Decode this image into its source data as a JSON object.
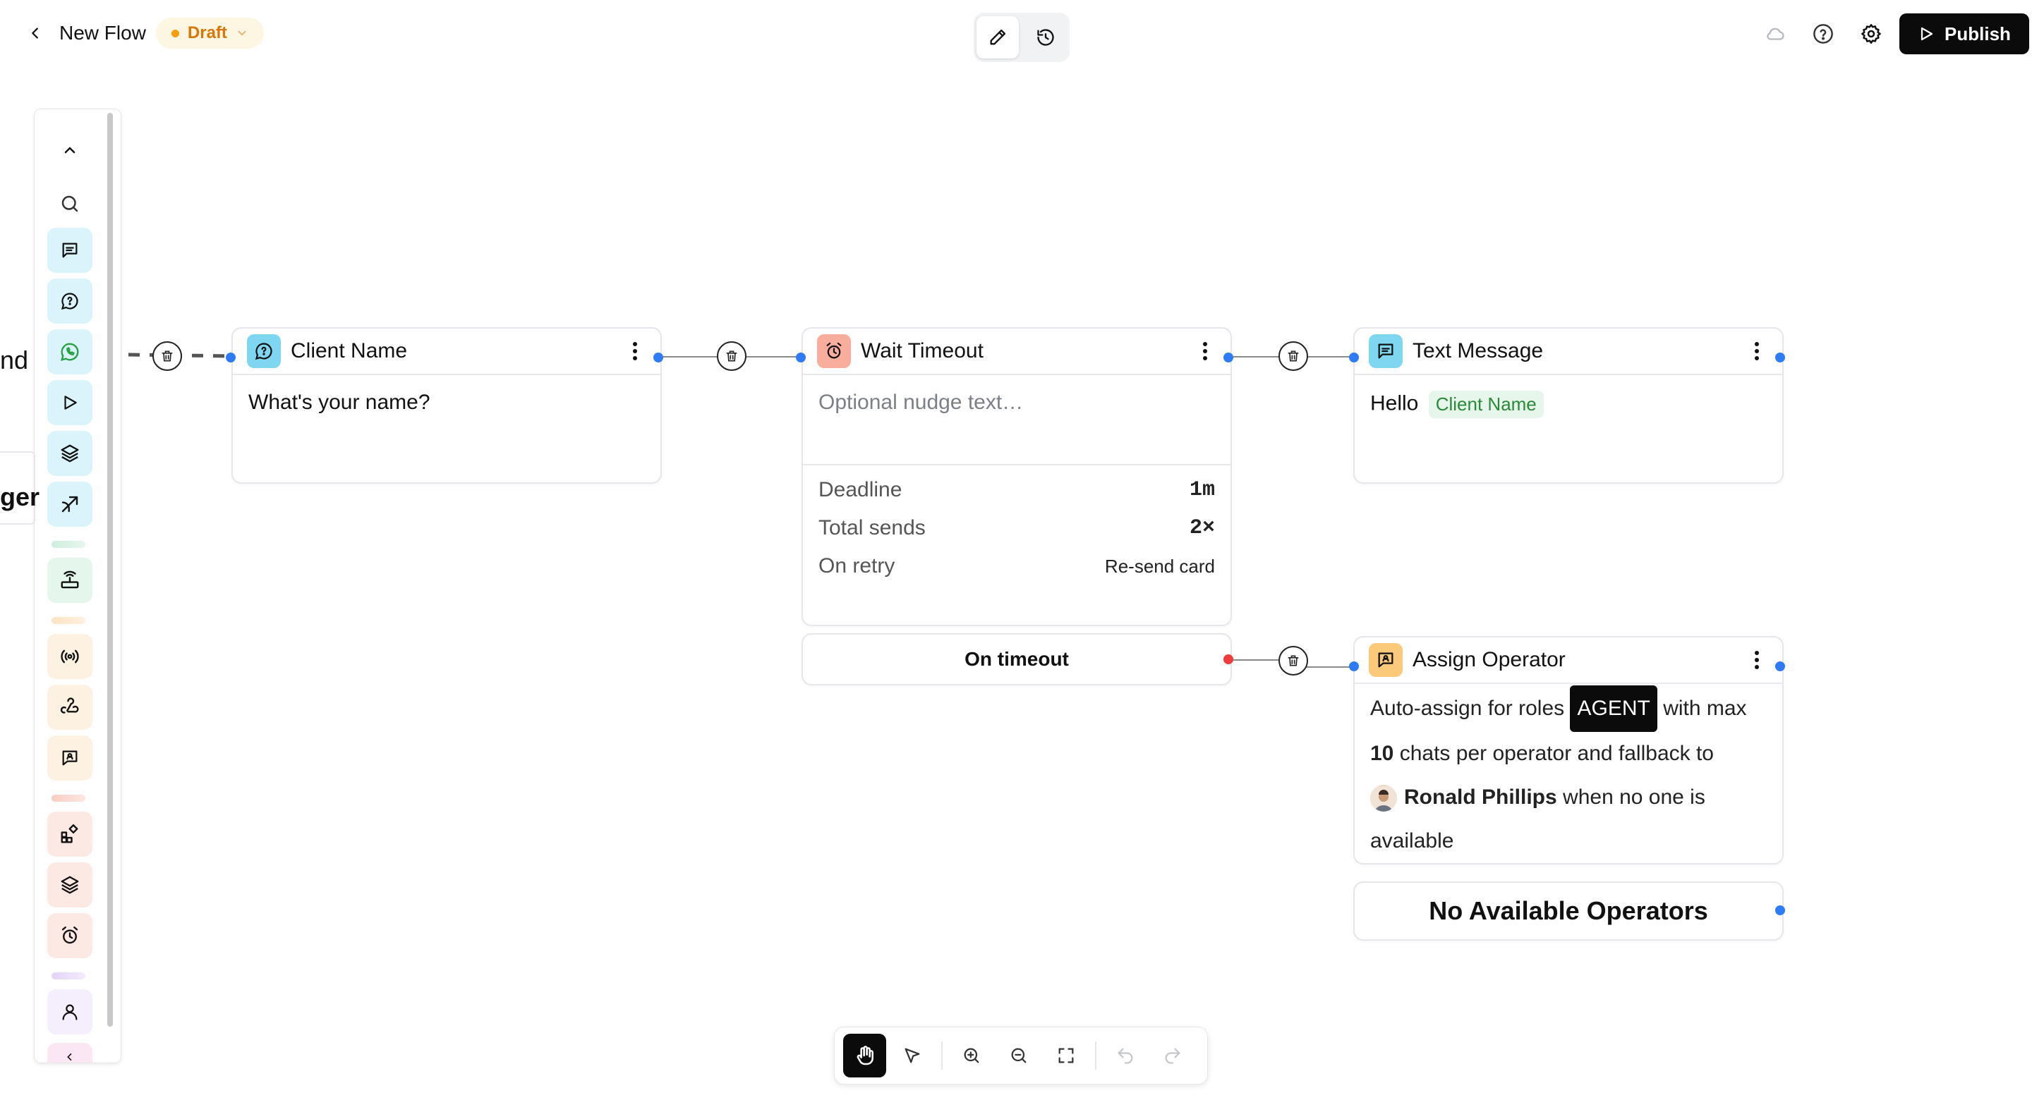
{
  "header": {
    "title": "New Flow",
    "status": "Draft",
    "publish_label": "Publish"
  },
  "canvas_fragments": {
    "left_text_1": "nd",
    "left_text_2": "ger"
  },
  "nodes": {
    "client_name": {
      "title": "Client Name",
      "body": "What's your name?"
    },
    "wait_timeout": {
      "title": "Wait Timeout",
      "placeholder": "Optional nudge text…",
      "rows": [
        {
          "label": "Deadline",
          "value": "1m"
        },
        {
          "label": "Total sends",
          "value": "2×"
        },
        {
          "label": "On retry",
          "value": "Re-send card"
        }
      ],
      "on_timeout_label": "On timeout"
    },
    "text_message": {
      "title": "Text Message",
      "greeting": "Hello",
      "variable": "Client Name"
    },
    "assign_operator": {
      "title": "Assign Operator",
      "text_1": "Auto-assign for roles",
      "role": "AGENT",
      "text_2": "with max",
      "max_chats": "10",
      "text_3": "chats per operator and fallback to",
      "fallback_name": "Ronald Phillips",
      "text_4": "when no one is",
      "text_5": "available",
      "no_operators_label": "No Available Operators"
    }
  },
  "colors": {
    "accent": "#2f7bf5",
    "timeout_port": "#ef3b3b",
    "draft": "#d97706",
    "publish_bg": "#0b0b0b"
  },
  "palette_icons": [
    "chevron-up-icon",
    "search-icon",
    "message-square-icon",
    "message-question-icon",
    "whatsapp-icon",
    "play-icon",
    "layers-icon",
    "route-icon",
    "router-icon",
    "broadcast-icon",
    "webhook-icon",
    "operator-chat-icon",
    "widgets-icon",
    "layers-icon",
    "alarm-icon",
    "user-icon"
  ]
}
